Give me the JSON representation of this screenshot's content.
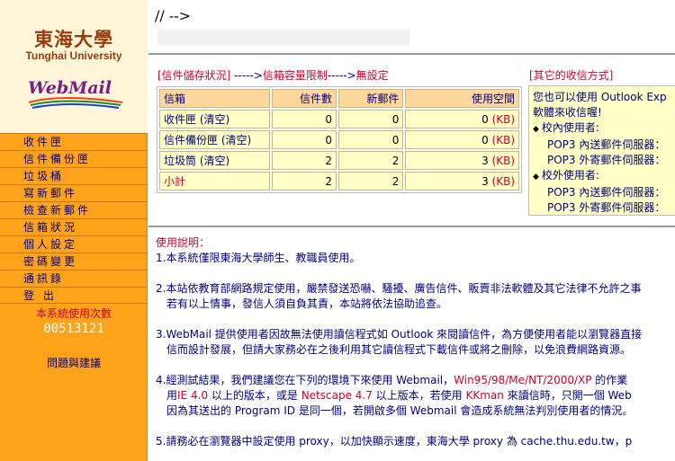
{
  "logo": {
    "name_cn": "東海大學",
    "name_en": "Tunghai University",
    "product": "WebMail"
  },
  "sidebar": {
    "items": [
      {
        "label": "收件匣"
      },
      {
        "label": "信件備份匣"
      },
      {
        "label": "垃圾桶"
      },
      {
        "label": "寫新郵件"
      },
      {
        "label": "檢查新郵件"
      },
      {
        "label": "信箱狀況"
      },
      {
        "label": "個人設定"
      },
      {
        "label": "密碼變更"
      },
      {
        "label": "通訊錄"
      },
      {
        "label": "登 出"
      }
    ],
    "counter_label": "本系統使用次數",
    "counter_value": "00513121",
    "feedback": "問題與建議"
  },
  "main": {
    "script_text": "// -->",
    "quota": {
      "status": "[信件儲存狀況]",
      "arrow1": "----->",
      "limit_label": "信箱容量限制",
      "arrow2": "----->",
      "limit_value": "無設定"
    },
    "table": {
      "headers": [
        "信箱",
        "信件數",
        "新郵件",
        "使用空間"
      ],
      "rows": [
        {
          "name": "收件匣  (清空)",
          "count": "0",
          "new": "0",
          "usage": "0",
          "unit": "(KB)"
        },
        {
          "name": "信件備份匣  (清空)",
          "count": "0",
          "new": "0",
          "usage": "0",
          "unit": "(KB)"
        },
        {
          "name": "垃圾筒  (清空)",
          "count": "2",
          "new": "2",
          "usage": "3",
          "unit": "(KB)"
        }
      ],
      "subtotal": {
        "name": "小計",
        "count": "2",
        "new": "2",
        "usage": "3",
        "unit": "(KB)"
      }
    },
    "other": {
      "title": "[其它的收信方式]",
      "line1": "您也可以使用 Outlook Exp",
      "line2": "軟體來收信喔!",
      "campus_in": "校內使用者:",
      "pop3_in": "POP3 內送郵件伺服器：",
      "pop3_out": "POP3 外寄郵件伺服器：",
      "campus_out": "校外使用者:",
      "pop3_in2": "POP3 內送郵件伺服器：",
      "pop3_out2": "POP3 外寄郵件伺服器："
    },
    "instructions": {
      "heading": "使用說明：",
      "item1": "1.本系統僅限東海大學師生、教職員使用。",
      "item2a": "2.本站依教育部網路規定使用，嚴禁發送恐嚇、騷擾、廣告信件、販賣非法軟體及其它法律不允許之事",
      "item2b": "若有以上情事，發信人須自負其責，本站將依法協助追查。",
      "item3a": "3.WebMail 提供使用者因故無法使用讀信程式如 Outlook 來閱讀信件，為方便使用者能以瀏覽器直接",
      "item3b": "信而設計發展，但請大家務必在之後利用其它讀信程式下載信件或將之刪除，以免浪費網路資源。",
      "item4a_pre": "4.經測試結果，我們建議您在下列的環境下來使用 Webmail，",
      "item4a_os": "Win95/98/Me/NT/2000/XP",
      "item4a_post": " 的作業",
      "item4b_pre": "用",
      "item4b_ie": "IE 4.0",
      "item4b_mid": " 以上的版本，或是 ",
      "item4b_ns": "Netscape 4.7",
      "item4b_mid2": " 以上版本，若使用 ",
      "item4b_kk": "KKman",
      "item4b_post": " 來讀信時，只開一個 Web",
      "item4c": "因為其送出的 Program ID 是同一個，若開啟多個 Webmail 會造成系統無法判別使用者的情況。",
      "item5": "5.請務必在瀏覽器中設定使用 proxy，以加快顯示速度，東海大學 proxy 為 cache.thu.edu.tw，p"
    }
  }
}
